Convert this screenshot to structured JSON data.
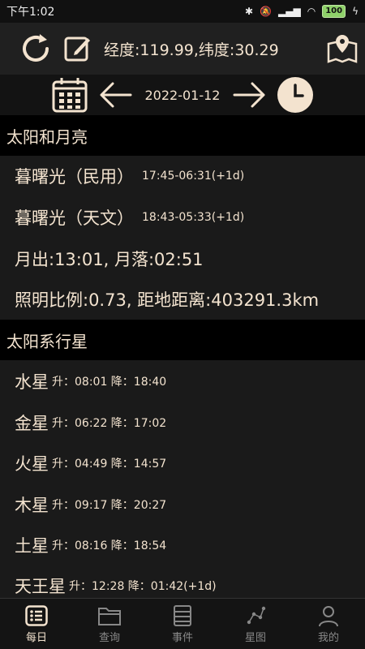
{
  "status": {
    "time": "下午1:02",
    "battery": "100"
  },
  "topbar": {
    "coords": "经度:119.99,纬度:30.29"
  },
  "datebar": {
    "date": "2022-01-12"
  },
  "sections": {
    "sun_moon": "太阳和月亮",
    "planets": "太阳系行星"
  },
  "sun_moon": {
    "civil_label": "暮曙光（民用）",
    "civil_value": "17:45-06:31(+1d)",
    "astro_label": "暮曙光（天文）",
    "astro_value": "18:43-05:33(+1d)",
    "moon_rise_set": "月出:13:01, 月落:02:51",
    "illumination": "照明比例:0.73, 距地距离:403291.3km"
  },
  "planets": [
    {
      "name": "水星",
      "detail": "升：08:01 降：18:40"
    },
    {
      "name": "金星",
      "detail": "升：06:22 降：17:02"
    },
    {
      "name": "火星",
      "detail": "升：04:49 降：14:57"
    },
    {
      "name": "木星",
      "detail": "升：09:17 降：20:27"
    },
    {
      "name": "土星",
      "detail": "升：08:16 降：18:54"
    },
    {
      "name": "天王星",
      "detail": "升：12:28 降：01:42(+1d)"
    }
  ],
  "nav": [
    {
      "label": "每日",
      "icon": "list-icon"
    },
    {
      "label": "查询",
      "icon": "folder-icon"
    },
    {
      "label": "事件",
      "icon": "table-icon"
    },
    {
      "label": "星图",
      "icon": "constellation-icon"
    },
    {
      "label": "我的",
      "icon": "person-icon"
    }
  ],
  "colors": {
    "accent": "#f3e3cf",
    "background": "#1a1a1a",
    "header": "#000000"
  }
}
